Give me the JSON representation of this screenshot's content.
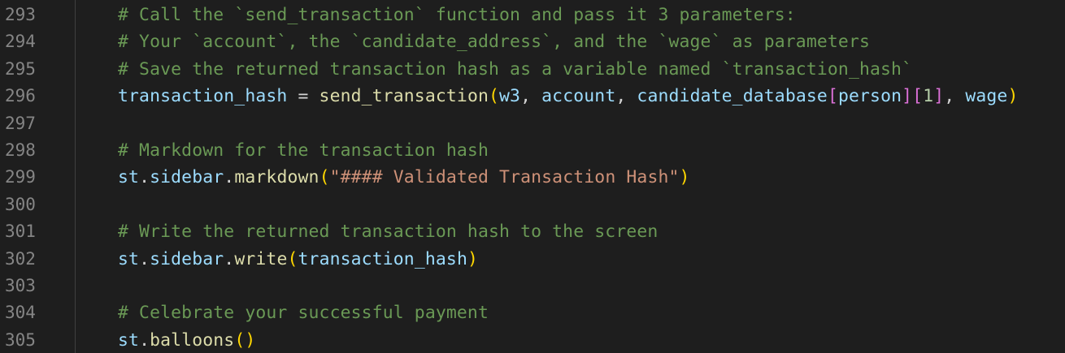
{
  "editor": {
    "lines": [
      {
        "no": "293",
        "tokens": [
          {
            "t": "# Call the `send_transaction` function and pass it 3 parameters:",
            "k": "comment"
          }
        ]
      },
      {
        "no": "294",
        "tokens": [
          {
            "t": "# Your `account`, the `candidate_address`, and the `wage` as parameters",
            "k": "comment"
          }
        ]
      },
      {
        "no": "295",
        "tokens": [
          {
            "t": "# Save the returned transaction hash as a variable named `transaction_hash`",
            "k": "comment"
          }
        ]
      },
      {
        "no": "296",
        "tokens": [
          {
            "t": "transaction_hash",
            "k": "var"
          },
          {
            "t": " = ",
            "k": "plain"
          },
          {
            "t": "send_transaction",
            "k": "fn"
          },
          {
            "t": "(",
            "k": "b1"
          },
          {
            "t": "w3",
            "k": "var"
          },
          {
            "t": ", ",
            "k": "plain"
          },
          {
            "t": "account",
            "k": "var"
          },
          {
            "t": ", ",
            "k": "plain"
          },
          {
            "t": "candidate_database",
            "k": "var"
          },
          {
            "t": "[",
            "k": "b2"
          },
          {
            "t": "person",
            "k": "var"
          },
          {
            "t": "]",
            "k": "b2"
          },
          {
            "t": "[",
            "k": "b2"
          },
          {
            "t": "1",
            "k": "num"
          },
          {
            "t": "]",
            "k": "b2"
          },
          {
            "t": ", ",
            "k": "plain"
          },
          {
            "t": "wage",
            "k": "var"
          },
          {
            "t": ")",
            "k": "b1"
          }
        ]
      },
      {
        "no": "297",
        "tokens": []
      },
      {
        "no": "298",
        "tokens": [
          {
            "t": "# Markdown for the transaction hash",
            "k": "comment"
          }
        ]
      },
      {
        "no": "299",
        "tokens": [
          {
            "t": "st",
            "k": "var"
          },
          {
            "t": ".",
            "k": "plain"
          },
          {
            "t": "sidebar",
            "k": "var"
          },
          {
            "t": ".",
            "k": "plain"
          },
          {
            "t": "markdown",
            "k": "fn"
          },
          {
            "t": "(",
            "k": "b1"
          },
          {
            "t": "\"#### Validated Transaction Hash\"",
            "k": "str"
          },
          {
            "t": ")",
            "k": "b1"
          }
        ]
      },
      {
        "no": "300",
        "tokens": []
      },
      {
        "no": "301",
        "tokens": [
          {
            "t": "# Write the returned transaction hash to the screen",
            "k": "comment"
          }
        ]
      },
      {
        "no": "302",
        "tokens": [
          {
            "t": "st",
            "k": "var"
          },
          {
            "t": ".",
            "k": "plain"
          },
          {
            "t": "sidebar",
            "k": "var"
          },
          {
            "t": ".",
            "k": "plain"
          },
          {
            "t": "write",
            "k": "fn"
          },
          {
            "t": "(",
            "k": "b1"
          },
          {
            "t": "transaction_hash",
            "k": "var"
          },
          {
            "t": ")",
            "k": "b1"
          }
        ]
      },
      {
        "no": "303",
        "tokens": []
      },
      {
        "no": "304",
        "tokens": [
          {
            "t": "# Celebrate your successful payment",
            "k": "comment"
          }
        ]
      },
      {
        "no": "305",
        "tokens": [
          {
            "t": "st",
            "k": "var"
          },
          {
            "t": ".",
            "k": "plain"
          },
          {
            "t": "balloons",
            "k": "fn"
          },
          {
            "t": "(",
            "k": "b1"
          },
          {
            "t": ")",
            "k": "b1"
          }
        ]
      }
    ]
  },
  "colors": {
    "background": "#1e1e1e",
    "line_number": "#858585",
    "comment": "#6a9955",
    "variable": "#9cdcfe",
    "function": "#dcdcaa",
    "string": "#ce9178",
    "number": "#b5cea8",
    "bracket_level1": "#ffd700",
    "bracket_level2": "#da70d6"
  }
}
